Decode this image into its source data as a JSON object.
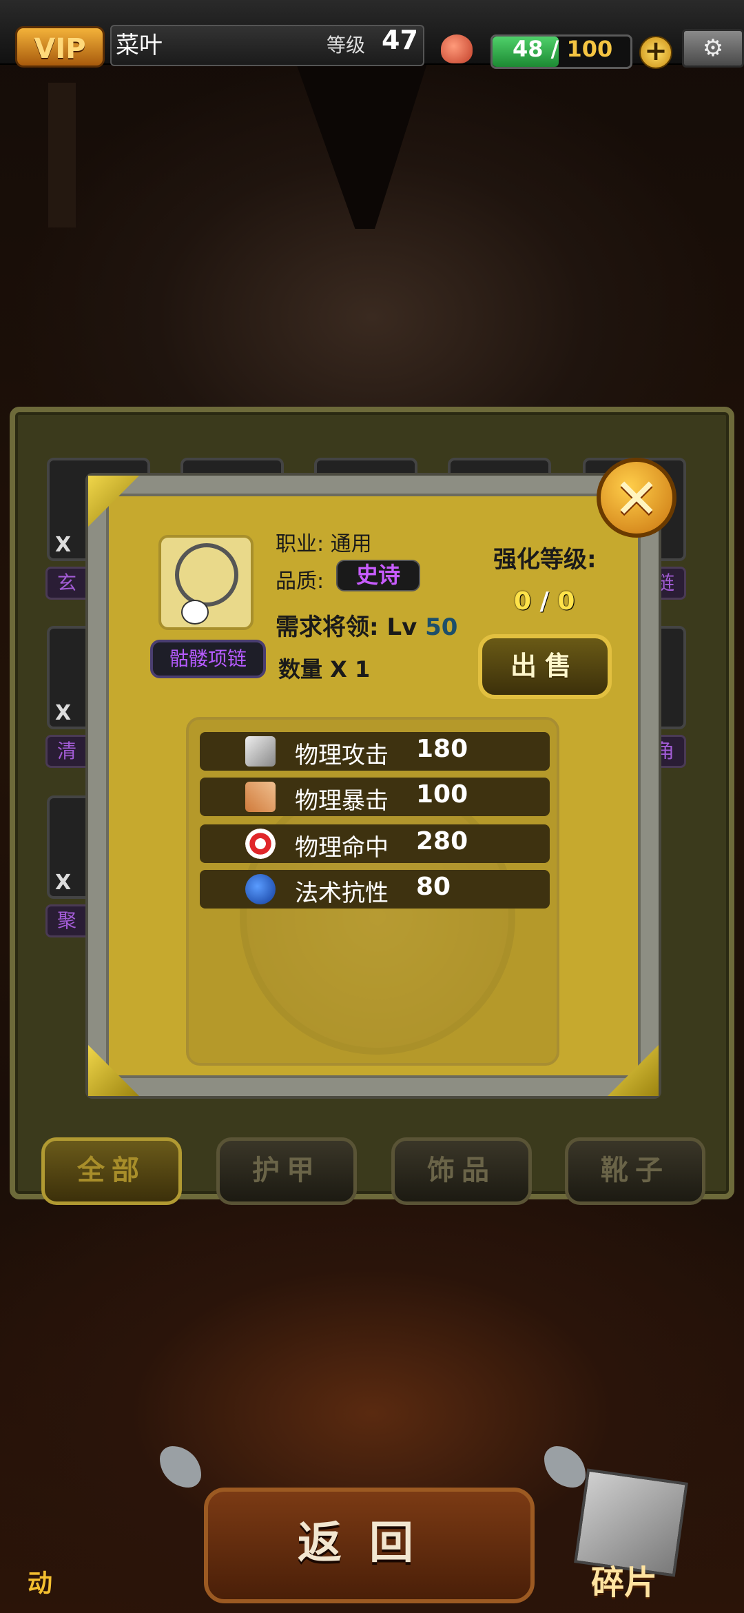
{
  "top_bar": {
    "vip_label": "VIP",
    "player_name": "菜叶",
    "level_label": "等级",
    "level_value": "47",
    "stamina_current": "48",
    "stamina_separator": "/",
    "stamina_max": "100",
    "stamina_fraction": 0.48,
    "add_stamina_symbol": "+",
    "settings_icon": "gear-icon"
  },
  "inventory": {
    "slots": [
      {
        "count": "X",
        "label": "玄"
      },
      {
        "count": "",
        "label": ""
      },
      {
        "count": "",
        "label": ""
      },
      {
        "count": "",
        "label": ""
      },
      {
        "count": "",
        "label": "链"
      },
      {
        "count": "X",
        "label": "清"
      },
      {
        "count": "",
        "label": "角"
      },
      {
        "count": "X",
        "label": "聚"
      }
    ],
    "tabs": [
      {
        "label": "全部",
        "active": true
      },
      {
        "label": "护甲",
        "active": false
      },
      {
        "label": "饰品",
        "active": false
      },
      {
        "label": "靴子",
        "active": false
      }
    ]
  },
  "item_detail": {
    "close_symbol": "✕",
    "item_name": "骷髅项链",
    "class_label": "职业:",
    "class_value": "通用",
    "quality_label": "品质:",
    "quality_value": "史诗",
    "requirement_label": "需求将领:",
    "requirement_prefix": "Lv",
    "requirement_level": "50",
    "quantity_text": "数量 X 1",
    "enhance_label": "强化等级:",
    "enhance_current": "0",
    "enhance_separator": "/",
    "enhance_max": "0",
    "sell_label": "出售",
    "stats": [
      {
        "icon": "sword-icon",
        "name": "物理攻击",
        "value": "180"
      },
      {
        "icon": "crossed-swords-icon",
        "name": "物理暴击",
        "value": "100"
      },
      {
        "icon": "target-icon",
        "name": "物理命中",
        "value": "280"
      },
      {
        "icon": "blue-orb-icon",
        "name": "法术抗性",
        "value": "80"
      }
    ]
  },
  "bottom": {
    "back_label": "返回",
    "shard_label": "碎片",
    "left_corner_text": "动"
  },
  "colors": {
    "popup_bg": "#c6a92e",
    "epic_purple": "#c85cff",
    "gold": "#f5c542"
  }
}
